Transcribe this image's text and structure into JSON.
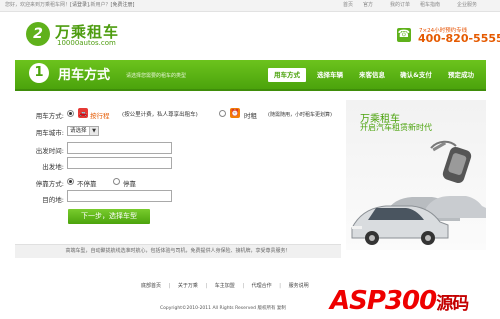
{
  "topbar": {
    "greeting": "您好，欢迎来到万乘租车网！",
    "login": "[请登录]",
    "new_user": "新用户？",
    "register": "[免费注册]",
    "links": [
      "首页",
      "官方",
      "我的订单",
      "租车指南",
      "企业服务"
    ]
  },
  "header": {
    "logo_text": "万乘租车",
    "logo_site": "10000autos.com",
    "phone_caption": "7×24小时预约专线",
    "phone_number": "400-820-5555"
  },
  "steps": {
    "current_number": "1",
    "current_title": "用车方式",
    "subtitle": "请选择您需要的租车的类型",
    "tabs": [
      "用车方式",
      "选择车辆",
      "来客信息",
      "确认&支付",
      "预定成功"
    ]
  },
  "form": {
    "usage_label": "用车方式:",
    "option1_label": "按行程",
    "option1_note": "(按公里计费，私人尊享出租车)",
    "option2_label": "时租",
    "option2_note": "(随需随用，小时租车更划算)",
    "city_label": "用车城市:",
    "city_value": "请选择",
    "time_label": "出发时间:",
    "location_label": "出发地:",
    "pickup_label": "停靠方式:",
    "pickup_opt1": "不停靠",
    "pickup_opt2": "停靠",
    "dest_label": "目的地:",
    "next_button": "下一步，选择车型"
  },
  "notice": "高端车型，自动聚拢航线选准时航心，包括体验与司机，免费提供人身保险、接机牌，享受尊贵服务！",
  "promo": {
    "line1": "万乘租车",
    "line2": "开启汽车租赁新时代"
  },
  "footer": {
    "links": [
      "底部首页",
      "关于万乘",
      "车主加盟",
      "代理合作",
      "服务说明"
    ],
    "copyright": "Copyright©2010-2011 All Rights Reserved 版权所有 复制"
  },
  "watermark": {
    "latin": "ASP300",
    "cn": "源码"
  },
  "colors": {
    "brand_green": "#5fb11b",
    "phone_orange": "#e55a00",
    "watermark_red": "#e00000"
  }
}
